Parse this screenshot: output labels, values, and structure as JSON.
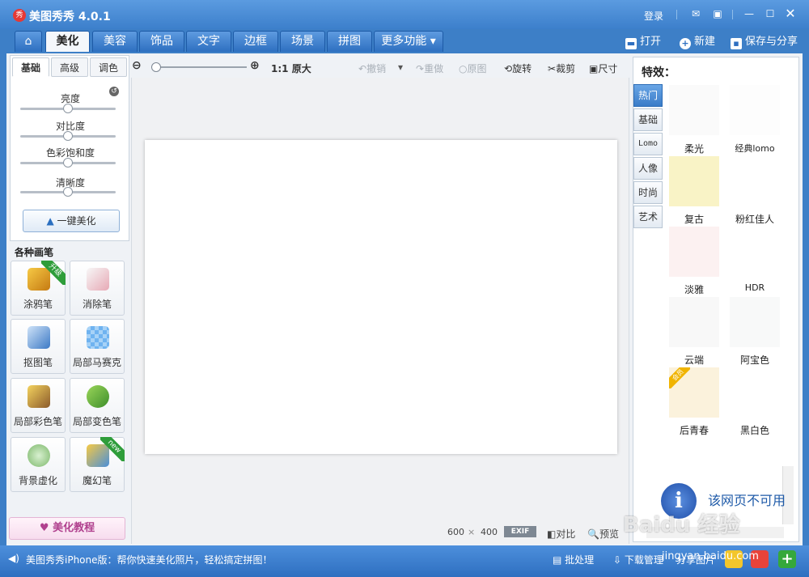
{
  "app": {
    "title": "美图秀秀 4.0.1",
    "login": "登录"
  },
  "tabs": [
    "美化",
    "美容",
    "饰品",
    "文字",
    "边框",
    "场景",
    "拼图",
    "更多功能 ▾"
  ],
  "actions": {
    "open": "打开",
    "new": "新建",
    "save_share": "保存与分享"
  },
  "left": {
    "subtabs": [
      "基础",
      "高级",
      "调色"
    ],
    "sliders": [
      {
        "label": "亮度",
        "value": 0.5
      },
      {
        "label": "对比度",
        "value": 0.5
      },
      {
        "label": "色彩饱和度",
        "value": 0.5
      },
      {
        "label": "清晰度",
        "value": 0.5
      }
    ],
    "onekey": "一键美化",
    "brushes_title": "各种画笔",
    "brushes": [
      "涂鸦笔",
      "消除笔",
      "抠图笔",
      "局部马赛克",
      "局部彩色笔",
      "局部变色笔",
      "背景虚化",
      "魔幻笔"
    ],
    "badges": {
      "upgrade": "升级",
      "new": "new"
    },
    "tutorial": "美化教程"
  },
  "toolbar": {
    "zoom_11": "1:1",
    "original_size": "原大",
    "undo": "撤销",
    "redo": "重做",
    "original": "原图",
    "rotate": "旋转",
    "crop": "裁剪",
    "size": "尺寸"
  },
  "canvas": {
    "width": "600",
    "x": "×",
    "height": "400",
    "exif": "EXIF",
    "compare": "对比",
    "preview": "预览"
  },
  "right": {
    "title": "特效：",
    "tabs": [
      "热门",
      "基础",
      "Lomo",
      "人像",
      "时尚",
      "艺术"
    ],
    "effects": [
      "柔光",
      "经典lomo",
      "复古",
      "粉红佳人",
      "淡雅",
      "HDR",
      "云端",
      "阿宝色",
      "后青春",
      "黑白色"
    ],
    "vip_badge": "会员",
    "notice": "该网页不可用"
  },
  "status": {
    "iphone": "美图秀秀iPhone版：帮你快速美化照片，轻松搞定拼图！",
    "batch": "批处理",
    "download": "下载管理",
    "share_pic": "分享图片"
  },
  "watermark": {
    "brand": "Baidu 经验",
    "url": "jingyan.baidu.com"
  },
  "colors": {
    "accent": "#3d7fc7",
    "ribbon_green": "#2e9d3a"
  }
}
